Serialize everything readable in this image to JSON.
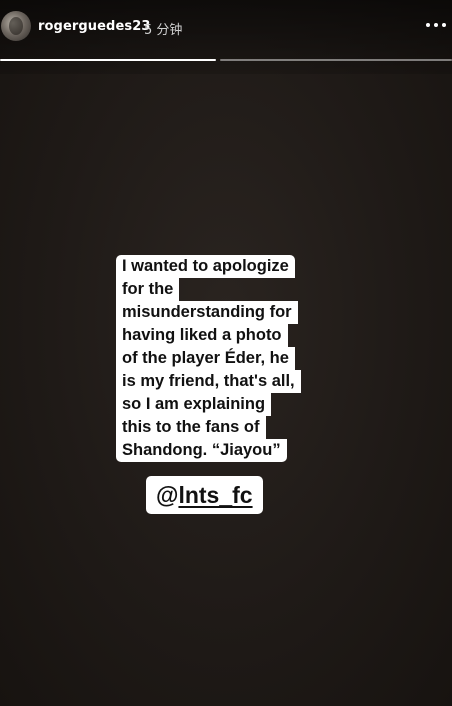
{
  "header": {
    "username": "rogerguedes23",
    "time": "5 分钟",
    "more_icon": "more-horizontal-icon"
  },
  "progress": {
    "segments": 2,
    "current_segment": 1
  },
  "caption": {
    "lines": [
      "I wanted to apologize",
      "for the",
      "misunderstanding for",
      "having liked a photo",
      "of the player Éder, he",
      "is my friend, that's all,",
      "so I am explaining",
      "this to the fans of",
      "Shandong. “Jiayou”"
    ]
  },
  "mention": {
    "at": "@",
    "handle": "lnts_fc"
  },
  "colors": {
    "background": "#1f1a17",
    "text_bg": "#ffffff",
    "text": "#111111"
  }
}
